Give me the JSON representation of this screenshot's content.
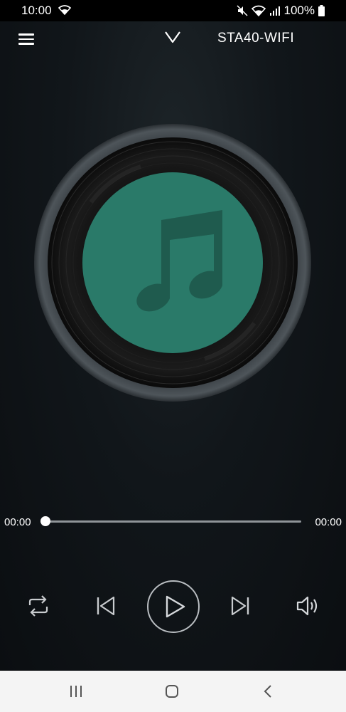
{
  "status_bar": {
    "time": "10:00",
    "battery_percent": "100%"
  },
  "header": {
    "device_name": "STA40-WIFI"
  },
  "player": {
    "current_time": "00:00",
    "total_time": "00:00",
    "progress": 0,
    "album_art_icon": "music-note-icon",
    "accent_color": "#2a7a69"
  },
  "controls": [
    {
      "name": "repeat",
      "icon": "repeat-icon"
    },
    {
      "name": "previous",
      "icon": "skip-previous-icon"
    },
    {
      "name": "play",
      "icon": "play-icon"
    },
    {
      "name": "next",
      "icon": "skip-next-icon"
    },
    {
      "name": "volume",
      "icon": "volume-icon"
    }
  ],
  "system_nav": {
    "recent_icon": "recent-apps-icon",
    "home_icon": "home-icon",
    "back_icon": "back-icon"
  }
}
